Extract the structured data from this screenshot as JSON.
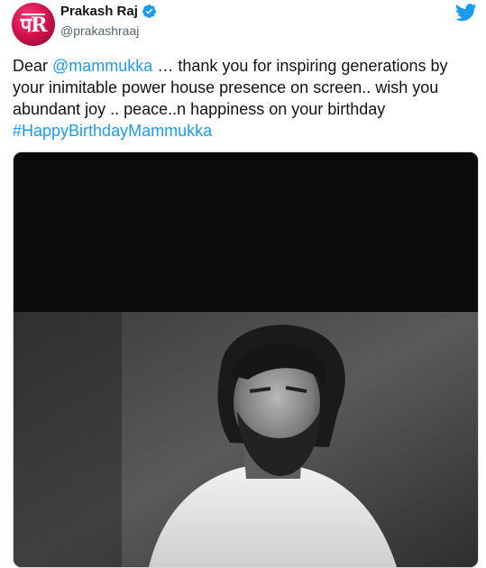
{
  "author": {
    "display_name": "Prakash Raj",
    "handle": "@prakashraaj",
    "avatar_icon": "pr-monogram-avatar",
    "verified_icon": "verified-badge-icon",
    "avatar_color": "#d6134f"
  },
  "platform_icon": "twitter-bird-icon",
  "tweet": {
    "line1_prefix": "Dear ",
    "mention": "@mammukka",
    "line1_suffix": " … thank you for inspiring generations by your inimitable power house presence on screen.. wish you abundant joy .. peace..n happiness on your birthday",
    "hashtag": "#HappyBirthdayMammukka"
  },
  "colors": {
    "link": "#1d9bf0",
    "text": "#0f1419",
    "secondary": "#536471"
  }
}
